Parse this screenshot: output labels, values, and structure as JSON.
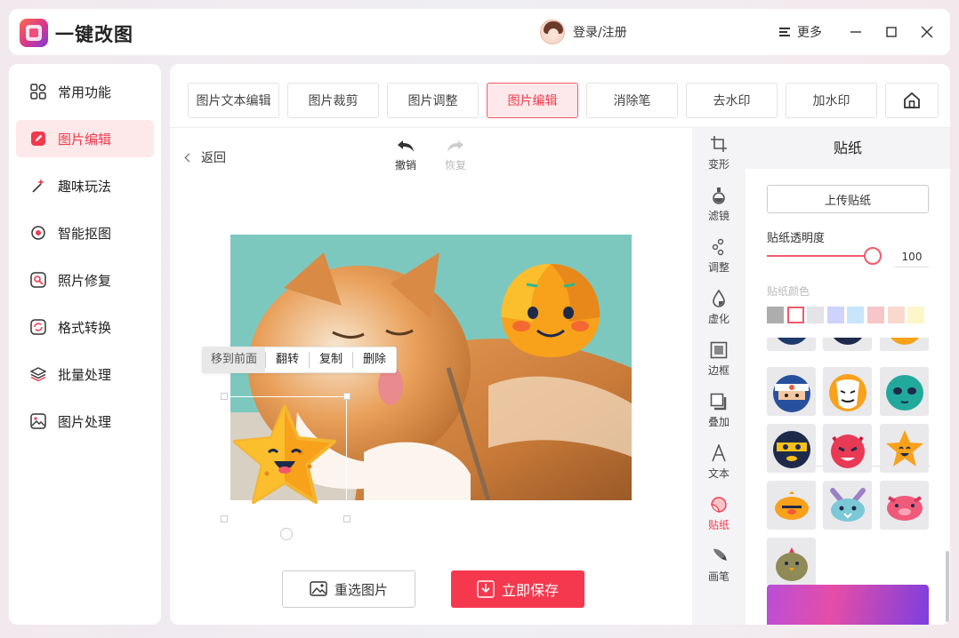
{
  "app": {
    "title": "一键改图",
    "login": "登录/注册",
    "more": "更多"
  },
  "sidebar": {
    "items": [
      {
        "label": "常用功能",
        "icon": "grid-icon"
      },
      {
        "label": "图片编辑",
        "icon": "edit-icon",
        "active": true
      },
      {
        "label": "趣味玩法",
        "icon": "magic-wand-icon"
      },
      {
        "label": "智能抠图",
        "icon": "target-icon"
      },
      {
        "label": "照片修复",
        "icon": "repair-icon"
      },
      {
        "label": "格式转换",
        "icon": "convert-icon"
      },
      {
        "label": "批量处理",
        "icon": "layers-icon"
      },
      {
        "label": "图片处理",
        "icon": "image-icon"
      }
    ]
  },
  "tabs": [
    {
      "label": "图片文本编辑"
    },
    {
      "label": "图片裁剪"
    },
    {
      "label": "图片调整"
    },
    {
      "label": "图片编辑",
      "active": true
    },
    {
      "label": "消除笔"
    },
    {
      "label": "去水印"
    },
    {
      "label": "加水印"
    }
  ],
  "editor": {
    "back": "返回",
    "undo": "撤销",
    "redo": "恢复",
    "context_menu": [
      "移到前面",
      "翻转",
      "复制",
      "删除"
    ],
    "reselect": "重选图片",
    "save": "立即保存"
  },
  "tools": [
    {
      "label": "变形",
      "icon": "transform-icon"
    },
    {
      "label": "滤镜",
      "icon": "filter-icon"
    },
    {
      "label": "调整",
      "icon": "adjust-icon"
    },
    {
      "label": "虚化",
      "icon": "blur-icon"
    },
    {
      "label": "边框",
      "icon": "frame-icon"
    },
    {
      "label": "叠加",
      "icon": "overlay-icon"
    },
    {
      "label": "文本",
      "icon": "text-icon"
    },
    {
      "label": "贴纸",
      "icon": "sticker-icon",
      "active": true
    },
    {
      "label": "画笔",
      "icon": "brush-icon"
    }
  ],
  "sticker_panel": {
    "title": "贴纸",
    "upload": "上传贴纸",
    "opacity_label": "贴纸透明度",
    "opacity_value": "100",
    "color_label": "贴纸颜色",
    "swatches": [
      "#adadad",
      "#ffffff",
      "#e3e3e8",
      "#cdd3fb",
      "#c8e5fb",
      "#f6c6c8",
      "#fbd8cc",
      "#fcf6c8"
    ],
    "stickers": [
      "ninja-sticker",
      "mask-sticker",
      "alien-sticker",
      "burglar-sticker",
      "devil-sticker",
      "star-sticker",
      "duck-sticker",
      "bunny-sticker",
      "pig-sticker",
      "chick-sticker"
    ]
  },
  "colors": {
    "accent": "#f6384e",
    "accent_light": "#fde8ea"
  }
}
